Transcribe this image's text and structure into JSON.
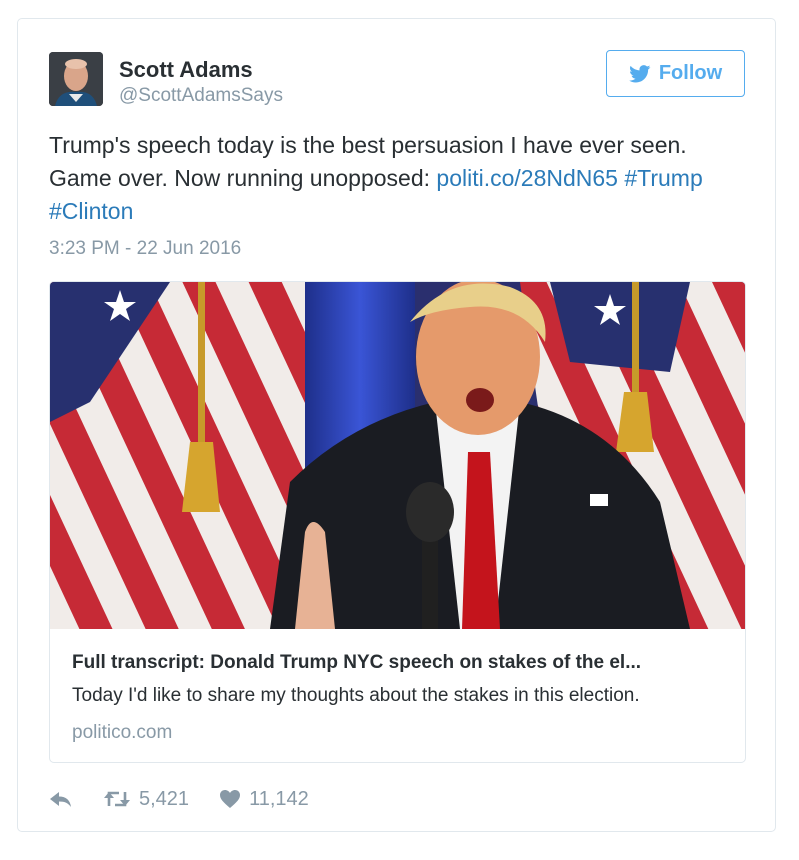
{
  "author": {
    "name": "Scott Adams",
    "handle": "@ScottAdamsSays",
    "avatar_icon": "profile-photo"
  },
  "follow_button": {
    "label": "Follow",
    "icon": "twitter-bird-icon",
    "color": "#55acee"
  },
  "tweet": {
    "text": "Trump's speech today is the best persuasion I have ever seen. Game over. Now running unopposed: ",
    "link": "politi.co/28NdN65",
    "hashtag1": "#Trump",
    "hashtag2": "#Clinton",
    "timestamp": "3:23 PM - 22 Jun 2016",
    "link_color": "#2b7bb9"
  },
  "card": {
    "image_icon": "speaker-at-podium-photo",
    "title": "Full transcript: Donald Trump NYC speech on stakes of the el...",
    "description": "Today I'd like to share my thoughts about the stakes in this election.",
    "domain": "politico.com"
  },
  "actions": {
    "reply_icon": "reply-icon",
    "retweet_icon": "retweet-icon",
    "retweets": "5,421",
    "like_icon": "heart-icon",
    "likes": "11,142"
  }
}
